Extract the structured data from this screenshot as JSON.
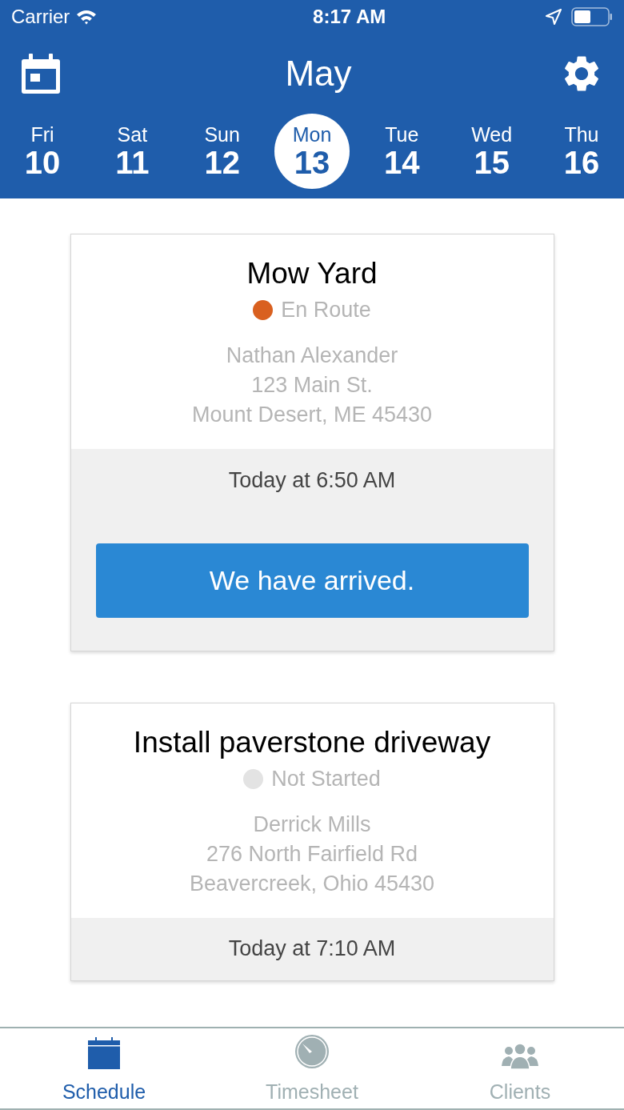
{
  "status_bar": {
    "carrier": "Carrier",
    "time": "8:17 AM"
  },
  "header": {
    "month": "May"
  },
  "days": [
    {
      "weekday": "Fri",
      "day": "10",
      "selected": false
    },
    {
      "weekday": "Sat",
      "day": "11",
      "selected": false
    },
    {
      "weekday": "Sun",
      "day": "12",
      "selected": false
    },
    {
      "weekday": "Mon",
      "day": "13",
      "selected": true
    },
    {
      "weekday": "Tue",
      "day": "14",
      "selected": false
    },
    {
      "weekday": "Wed",
      "day": "15",
      "selected": false
    },
    {
      "weekday": "Thu",
      "day": "16",
      "selected": false
    }
  ],
  "jobs": [
    {
      "title": "Mow Yard",
      "status": "En Route",
      "color": "#d9601f",
      "client": "Nathan Alexander",
      "address": [
        "123 Main St.",
        "Mount Desert, ME 45430"
      ],
      "time": "Today at 6:50 AM",
      "action": "We have arrived."
    },
    {
      "title": "Install paverstone driveway",
      "status": "Not Started",
      "color": "#e3e3e3",
      "client": "Derrick Mills",
      "address": [
        "276 North Fairfield Rd",
        "Beavercreek, Ohio 45430"
      ],
      "time": "Today at 7:10 AM"
    }
  ],
  "tabs": [
    {
      "label": "Schedule",
      "kind": "calendar",
      "selected": true
    },
    {
      "label": "Timesheet",
      "kind": "clock",
      "selected": false
    },
    {
      "label": "Clients",
      "kind": "people",
      "selected": false
    }
  ]
}
